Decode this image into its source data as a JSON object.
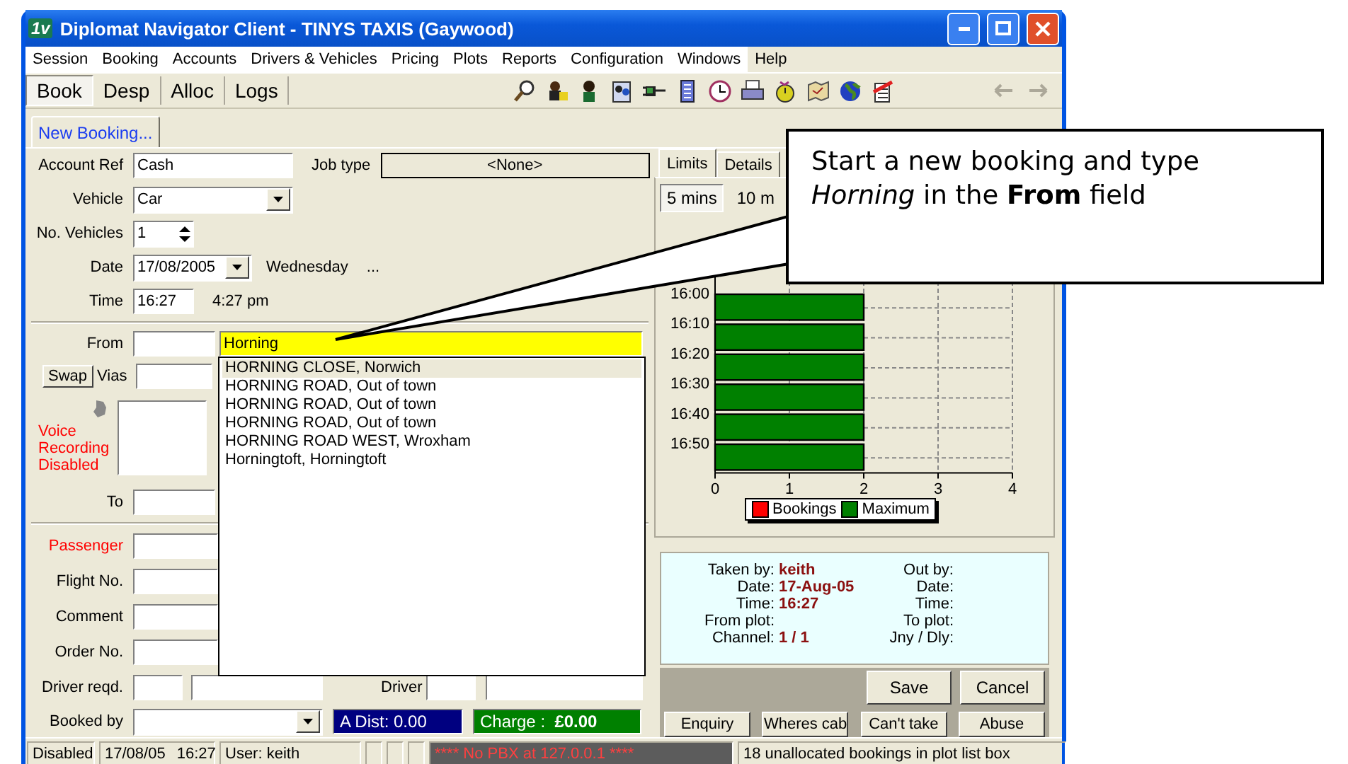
{
  "window": {
    "title": "Diplomat Navigator Client - TINYS TAXIS (Gaywood)",
    "logo_text": "1v"
  },
  "menu": [
    "Session",
    "Booking",
    "Accounts",
    "Drivers & Vehicles",
    "Pricing",
    "Plots",
    "Reports",
    "Configuration",
    "Windows",
    "Help"
  ],
  "mode_tabs": [
    {
      "label": "Book",
      "selected": true
    },
    {
      "label": "Desp",
      "selected": false
    },
    {
      "label": "Alloc",
      "selected": false
    },
    {
      "label": "Logs",
      "selected": false
    }
  ],
  "nav_buttons": [
    {
      "kind": "back",
      "disabled": true
    },
    {
      "kind": "forward",
      "disabled": true
    }
  ],
  "form_tabs": [
    {
      "label": "New Booking...",
      "selected": true
    }
  ],
  "account_ref": {
    "label": "Account Ref",
    "value": "Cash"
  },
  "job_type": {
    "label": "Job type",
    "value": "<None>"
  },
  "vehicle": {
    "label": "Vehicle",
    "value": "Car"
  },
  "no_vehicles": {
    "label": "No. Vehicles",
    "value": "1"
  },
  "date": {
    "label": "Date",
    "value": "17/08/2005",
    "weekday": "Wednesday",
    "more": "..."
  },
  "time": {
    "label": "Time",
    "value": "16:27",
    "twelve_hour": "4:27 pm"
  },
  "from": {
    "label": "From",
    "value": "Horning"
  },
  "swap_button": "Swap",
  "vias_label": "Vias",
  "voice_status": "Voice Recording Disabled",
  "to": {
    "label": "To"
  },
  "details": [
    {
      "label": "Passenger",
      "required": true
    },
    {
      "label": "Flight No.",
      "required": false
    },
    {
      "label": "Comment",
      "required": false
    },
    {
      "label": "Order No.",
      "required": false
    }
  ],
  "driver_reqd": {
    "label": "Driver reqd."
  },
  "driver": {
    "label": "Driver"
  },
  "booked_by": {
    "label": "Booked by"
  },
  "distance": "A Dist: 0.00",
  "charge": {
    "label": "Charge :",
    "value": "£0.00"
  },
  "suggestions": [
    {
      "text": "HORNING CLOSE, Norwich",
      "selected": true
    },
    {
      "text": "HORNING ROAD, Out of town",
      "selected": false
    },
    {
      "text": "HORNING ROAD, Out of town",
      "selected": false
    },
    {
      "text": "HORNING ROAD, Out of town",
      "selected": false
    },
    {
      "text": "HORNING ROAD WEST, Wroxham",
      "selected": false
    },
    {
      "text": "Horningtoft, Horningtoft",
      "selected": false
    }
  ],
  "side_tabs": [
    {
      "label": "Limits",
      "selected": true
    },
    {
      "label": "Details",
      "selected": false
    }
  ],
  "intervals": [
    {
      "label": "5 mins",
      "selected": true
    },
    {
      "label": "10 m",
      "selected": false
    }
  ],
  "chart_data": {
    "type": "bar",
    "orientation": "horizontal",
    "categories": [
      "16:00",
      "16:10",
      "16:20",
      "16:30",
      "16:40",
      "16:50"
    ],
    "series": [
      {
        "name": "Bookings",
        "color": "#ff0000",
        "values": [
          0,
          0,
          0,
          0,
          0,
          0
        ]
      },
      {
        "name": "Maximum",
        "color": "#008000",
        "values": [
          2,
          2,
          2,
          2,
          2,
          2
        ]
      }
    ],
    "xlim": [
      0,
      4
    ],
    "xticks": [
      0,
      1,
      2,
      3,
      4
    ],
    "grid": true
  },
  "audit": {
    "left": [
      {
        "label": "Taken by:",
        "value": "keith"
      },
      {
        "label": "Date:",
        "value": "17-Aug-05"
      },
      {
        "label": "Time:",
        "value": "16:27"
      },
      {
        "label": "From plot:"
      },
      {
        "label": "Channel:",
        "value": "1 / 1"
      }
    ],
    "right": [
      {
        "label": "Out by:"
      },
      {
        "label": "Date:"
      },
      {
        "label": "Time:"
      },
      {
        "label": "To plot:"
      },
      {
        "label": "Jny / Dly:"
      }
    ]
  },
  "actions": [
    "Save",
    "Cancel"
  ],
  "quick_actions": [
    "Enquiry",
    "Wheres cab",
    "Can't take",
    "Abuse"
  ],
  "status_bar": {
    "mode": "Disabled",
    "date": "17/08/05",
    "time": "16:27",
    "user": "User: keith",
    "pbx_alert": "**** No PBX at 127.0.0.1 ****",
    "message": "18 unallocated bookings in plot list box"
  },
  "callout": {
    "text": "Start a new booking and type *Horning* in the **From** field"
  }
}
